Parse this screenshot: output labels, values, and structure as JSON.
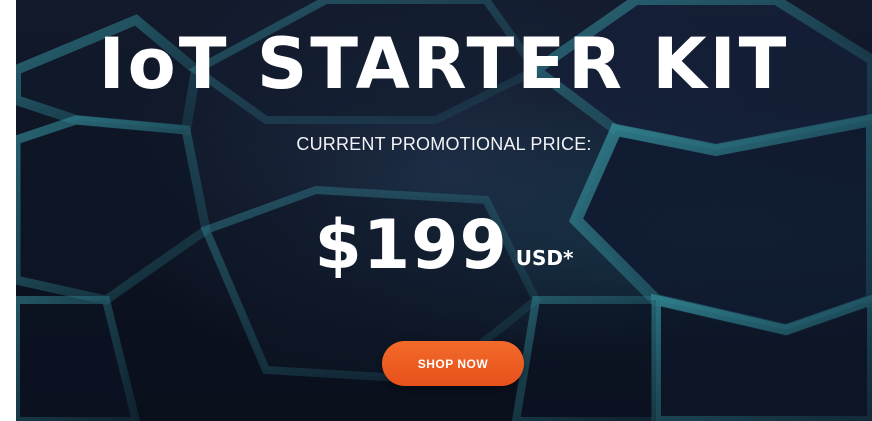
{
  "hero": {
    "title": "IoT STARTER KIT",
    "subtitle": "CURRENT PROMOTIONAL PRICE:",
    "price": "$199",
    "currency": "USD*",
    "cta_label": "SHOP NOW"
  },
  "colors": {
    "background": "#0b0f1d",
    "hex_glow": "#2a8a96",
    "cta": "#ee5d22",
    "text": "#ffffff"
  }
}
